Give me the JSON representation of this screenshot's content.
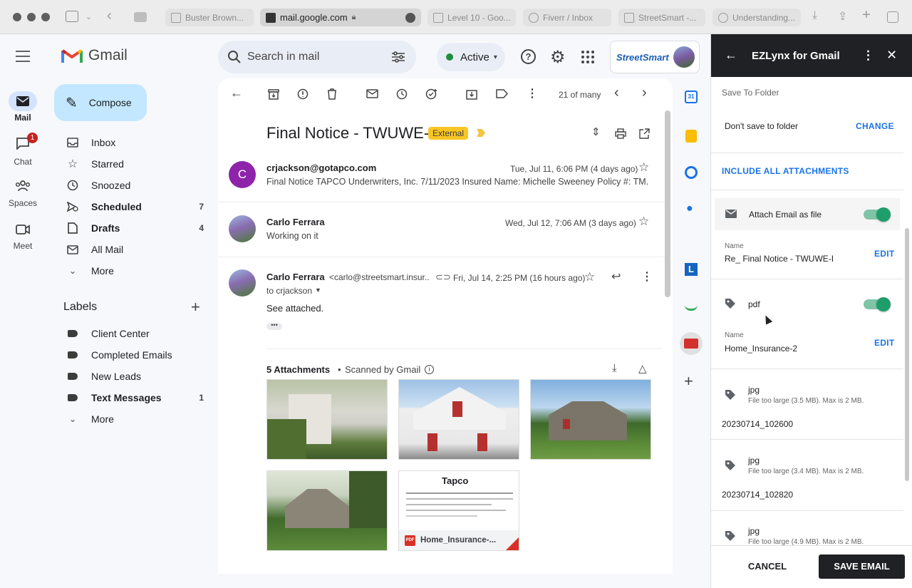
{
  "browser": {
    "tabs": [
      {
        "label": "Buster Brown..."
      },
      {
        "label": "mail.google.com"
      },
      {
        "label": "Level 10 - Goo..."
      },
      {
        "label": "Fiverr / Inbox"
      },
      {
        "label": "StreetSmart -..."
      },
      {
        "label": "Understanding..."
      }
    ]
  },
  "gmail": {
    "logo_text": "Gmail",
    "search_placeholder": "Search in mail",
    "status": "Active",
    "brand_badge": "StreetSmart",
    "rail": {
      "mail": "Mail",
      "chat": "Chat",
      "chat_badge": "1",
      "spaces": "Spaces",
      "meet": "Meet"
    },
    "compose": "Compose",
    "nav": [
      {
        "label": "Inbox",
        "count": ""
      },
      {
        "label": "Starred",
        "count": ""
      },
      {
        "label": "Snoozed",
        "count": ""
      },
      {
        "label": "Scheduled",
        "count": "7"
      },
      {
        "label": "Drafts",
        "count": "4"
      },
      {
        "label": "All Mail",
        "count": ""
      },
      {
        "label": "More",
        "count": ""
      }
    ],
    "labels_heading": "Labels",
    "labels": [
      {
        "label": "Client Center",
        "count": ""
      },
      {
        "label": "Completed Emails",
        "count": ""
      },
      {
        "label": "New Leads",
        "count": ""
      },
      {
        "label": "Text Messages",
        "count": "1"
      },
      {
        "label": "More",
        "count": ""
      }
    ]
  },
  "thread": {
    "pager": "21 of many",
    "subject": "Final Notice - TWUWE-I",
    "external_badge": "External",
    "messages": [
      {
        "avatar_letter": "C",
        "sender": "crjackson@gotapco.com",
        "date": "Tue, Jul 11, 6:06 PM (4 days ago)",
        "snippet": "Final Notice TAPCO Underwriters, Inc. 7/11/2023 Insured Name: Michelle Sweeney Policy #: TM..."
      },
      {
        "sender": "Carlo Ferrara",
        "date": "Wed, Jul 12, 7:06 AM (3 days ago)",
        "snippet": "Working on it"
      },
      {
        "sender": "Carlo Ferrara",
        "sender_email": "<carlo@streetsmart.insur...",
        "date": "Fri, Jul 14, 2:25 PM (16 hours ago)",
        "to": "to crjackson",
        "body": "See attached."
      }
    ],
    "attachments_title": "5 Attachments",
    "scanned": "Scanned by Gmail",
    "pdf_name": "Home_Insurance-...",
    "doc_brand": "Tapco"
  },
  "panel": {
    "title": "EZLynx for Gmail",
    "save_to_folder": "Save To Folder",
    "folder_value": "Don't save to folder",
    "change": "CHANGE",
    "include_all": "INCLUDE ALL ATTACHMENTS",
    "attach_email": "Attach Email as file",
    "name_label": "Name",
    "email_name": "Re_ Final Notice - TWUWE-I",
    "edit": "EDIT",
    "pdf_type": "pdf",
    "pdf_name": "Home_Insurance-2",
    "files": [
      {
        "type": "jpg",
        "note": "File too large (3.5 MB). Max is 2 MB.",
        "name": "20230714_102600"
      },
      {
        "type": "jpg",
        "note": "File too large (3.4 MB). Max is 2 MB.",
        "name": "20230714_102820"
      },
      {
        "type": "jpg",
        "note": "File too large (4.9 MB). Max is 2 MB."
      }
    ],
    "cancel": "CANCEL",
    "save_email": "SAVE EMAIL"
  },
  "colors": {
    "accent": "#1a73e8",
    "toggle": "#1e9e6a",
    "panel_header": "#202124",
    "external_badge": "#f9c623"
  }
}
